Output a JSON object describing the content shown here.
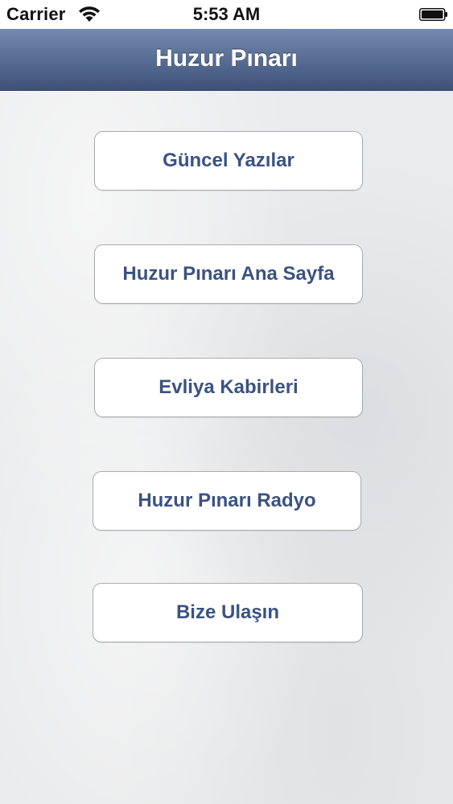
{
  "status_bar": {
    "carrier": "Carrier",
    "time": "5:53 AM",
    "wifi_icon": "wifi-icon",
    "battery_icon": "battery-icon"
  },
  "nav": {
    "title": "Huzur Pınarı"
  },
  "menu": {
    "items": [
      {
        "label": "Güncel Yazılar"
      },
      {
        "label": "Huzur Pınarı Ana Sayfa"
      },
      {
        "label": "Evliya Kabirleri"
      },
      {
        "label": "Huzur Pınarı Radyo"
      },
      {
        "label": "Bize Ulaşın"
      }
    ]
  },
  "colors": {
    "nav_gradient_top": "#7389ad",
    "nav_gradient_bottom": "#3e5279",
    "button_text": "#3b5282",
    "background": "#eaebec"
  }
}
